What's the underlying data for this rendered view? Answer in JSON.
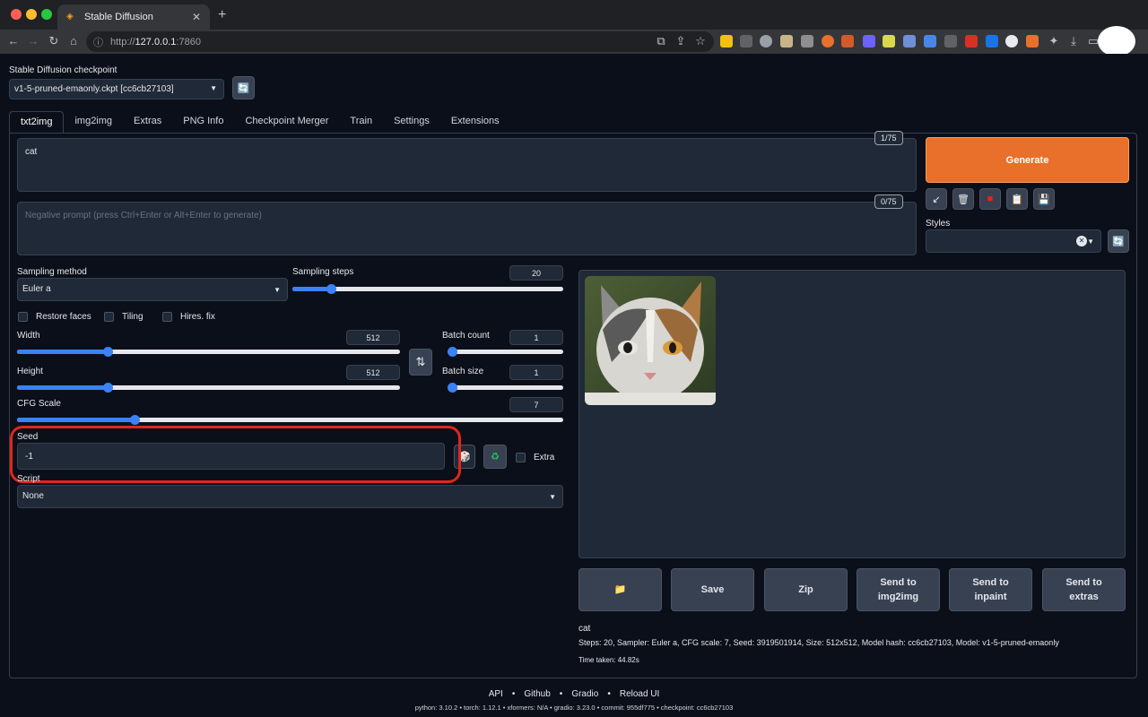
{
  "browser": {
    "tab_title": "Stable Diffusion",
    "url_scheme": "http://",
    "url_host": "127.0.0.1",
    "url_port": ":7860"
  },
  "checkpoint": {
    "label": "Stable Diffusion checkpoint",
    "value": "v1-5-pruned-emaonly.ckpt [cc6cb27103]"
  },
  "tabs": [
    "txt2img",
    "img2img",
    "Extras",
    "PNG Info",
    "Checkpoint Merger",
    "Train",
    "Settings",
    "Extensions"
  ],
  "prompt": {
    "value": "cat",
    "counter": "1/75",
    "negative_placeholder": "Negative prompt (press Ctrl+Enter or Alt+Enter to generate)",
    "negative_counter": "0/75"
  },
  "generate_label": "Generate",
  "styles_label": "Styles",
  "sampling": {
    "method_label": "Sampling method",
    "method_value": "Euler a",
    "steps_label": "Sampling steps",
    "steps_value": "20",
    "steps_fraction": 0.13
  },
  "checkboxes": {
    "restore_faces": "Restore faces",
    "tiling": "Tiling",
    "hires": "Hires. fix",
    "extra": "Extra"
  },
  "width": {
    "label": "Width",
    "value": "512",
    "fraction": 0.23
  },
  "height": {
    "label": "Height",
    "value": "512",
    "fraction": 0.23
  },
  "batch_count": {
    "label": "Batch count",
    "value": "1",
    "fraction": 0.0
  },
  "batch_size": {
    "label": "Batch size",
    "value": "1",
    "fraction": 0.0
  },
  "cfg": {
    "label": "CFG Scale",
    "value": "7",
    "fraction": 0.21
  },
  "seed": {
    "label": "Seed",
    "value": "-1"
  },
  "script": {
    "label": "Script",
    "value": "None"
  },
  "output_buttons": {
    "save": "Save",
    "zip": "Zip",
    "send_img2img": "Send to img2img",
    "send_inpaint": "Send to inpaint",
    "send_extras": "Send to extras"
  },
  "output_info": {
    "prompt": "cat",
    "params": "Steps: 20, Sampler: Euler a, CFG scale: 7, Seed: 3919501914, Size: 512x512, Model hash: cc6cb27103, Model: v1-5-pruned-emaonly",
    "time": "Time taken: 44.82s"
  },
  "footer": {
    "links": [
      "API",
      "Github",
      "Gradio",
      "Reload UI"
    ],
    "meta": "python: 3.10.2  •  torch: 1.12.1  •  xformers: N/A  •  gradio: 3.23.0  •  commit: 955df775  •  checkpoint: cc6cb27103"
  },
  "colors": {
    "accent_orange": "#e8702a",
    "slider_blue": "#3b82f6",
    "highlight_red": "#e0261b"
  }
}
